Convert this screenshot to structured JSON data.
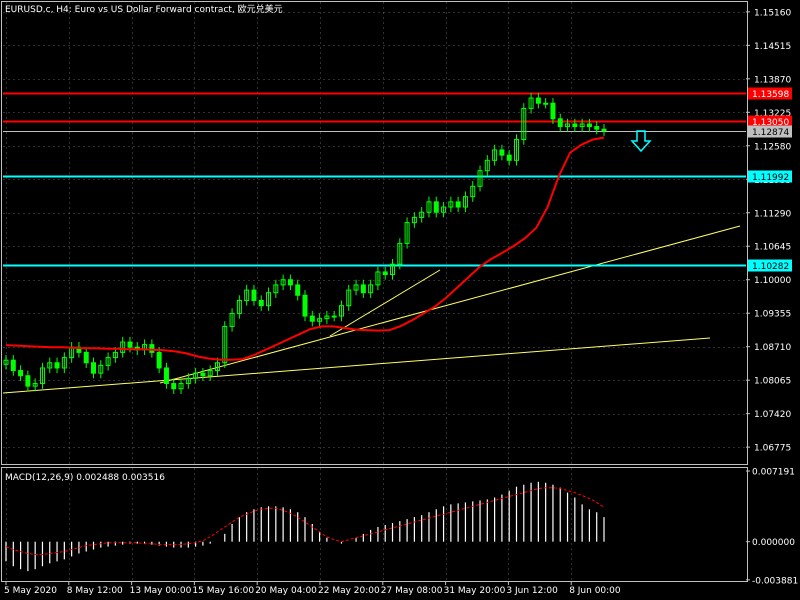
{
  "header": {
    "title": "EURUSD.c, H4:  Euro vs US Dollar Forward contract, 欧元兑美元",
    "macd_label": "MACD(12,26,9) 0.002488 0.003516"
  },
  "colors": {
    "background": "#000000",
    "grid": "#c0c0c0",
    "bull": "#00ff00",
    "ma": "#ff0000",
    "resistance": "#ff0000",
    "support": "#00ffff",
    "trend": "#ffff66",
    "arrow": "#00ffff",
    "macd_hist": "#ffffff",
    "macd_signal": "#ff0000",
    "price_tag": "#c0c0c0"
  },
  "price_axis": {
    "ticks": [
      "1.15160",
      "1.14515",
      "1.13870",
      "1.13225",
      "1.12580",
      "1.11935",
      "1.11290",
      "1.10645",
      "1.10000",
      "1.09355",
      "1.08710",
      "1.08065",
      "1.07420",
      "1.06775"
    ],
    "min": 1.0645,
    "max": 1.1535
  },
  "levels": [
    {
      "name": "resistance-high",
      "price": 1.13598,
      "label": "1.13598",
      "color": "#ff0000",
      "text_color": "#ffffff"
    },
    {
      "name": "resistance-low",
      "price": 1.1305,
      "label": "1.13050",
      "color": "#ff0000",
      "text_color": "#ffffff"
    },
    {
      "name": "current-price",
      "price": 1.12874,
      "label": "1.12874",
      "color": "#c0c0c0",
      "text_color": "#000000"
    },
    {
      "name": "support-high",
      "price": 1.11992,
      "label": "1.11992",
      "color": "#00ffff",
      "text_color": "#000000"
    },
    {
      "name": "support-low",
      "price": 1.10282,
      "label": "1.10282",
      "color": "#00ffff",
      "text_color": "#000000"
    }
  ],
  "time_axis": {
    "labels": [
      "5 May 2020",
      "8 May 12:00",
      "13 May 00:00",
      "15 May 16:00",
      "20 May 04:00",
      "22 May 20:00",
      "27 May 08:00",
      "31 May 20:00",
      "3 Jun 12:00",
      "8 Jun 00:00"
    ]
  },
  "macd_axis": {
    "ticks": [
      "0.007191",
      "0.000000",
      "-0.003881"
    ],
    "max": 0.0075,
    "min": -0.004
  },
  "chart_data": {
    "type": "line",
    "title": "EURUSD.c, H4",
    "series": [
      {
        "name": "EURUSD.c",
        "values": [
          1.0845,
          1.0825,
          1.0815,
          1.0795,
          1.08,
          1.083,
          1.084,
          1.083,
          1.085,
          1.087,
          1.086,
          1.084,
          1.082,
          1.0835,
          1.085,
          1.086,
          1.088,
          1.087,
          1.0865,
          1.0875,
          1.086,
          1.083,
          1.08,
          1.079,
          1.08,
          1.081,
          1.082,
          1.0815,
          1.0825,
          1.084,
          1.091,
          1.0935,
          1.096,
          1.098,
          1.096,
          1.095,
          1.0975,
          1.099,
          1.1,
          1.099,
          1.097,
          1.093,
          1.092,
          1.0925,
          1.093,
          1.093,
          1.095,
          1.098,
          1.099,
          1.0975,
          1.099,
          1.1015,
          1.101,
          1.103,
          1.107,
          1.111,
          1.112,
          1.113,
          1.115,
          1.113,
          1.114,
          1.115,
          1.114,
          1.116,
          1.118,
          1.121,
          1.123,
          1.125,
          1.124,
          1.123,
          1.127,
          1.133,
          1.135,
          1.134,
          1.134,
          1.131,
          1.1295,
          1.13,
          1.1295,
          1.13,
          1.1295,
          1.129,
          1.1287
        ]
      },
      {
        "name": "MA",
        "values": [
          1.0874,
          1.0873,
          1.0872,
          1.0871,
          1.087,
          1.087,
          1.0869,
          1.0868,
          1.0868,
          1.0867,
          1.0867,
          1.0866,
          1.0866,
          1.0865,
          1.0864,
          1.0862,
          1.0858,
          1.0852,
          1.0848,
          1.0846,
          1.0846,
          1.0847,
          1.0855,
          1.0865,
          1.0875,
          1.0885,
          1.0895,
          1.0905,
          1.091,
          1.091,
          1.0907,
          1.0904,
          1.0903,
          1.0902,
          1.0903,
          1.0911,
          1.0922,
          1.0935,
          1.0948,
          1.0965,
          1.0985,
          1.1005,
          1.1025,
          1.104,
          1.1052,
          1.1065,
          1.108,
          1.11,
          1.114,
          1.12,
          1.1245,
          1.126,
          1.127,
          1.1274
        ]
      }
    ],
    "macd": {
      "histogram": [
        -0.002,
        -0.0025,
        -0.0028,
        -0.003,
        -0.0028,
        -0.0025,
        -0.0022,
        -0.002,
        -0.0018,
        -0.0015,
        -0.0012,
        -0.001,
        -0.0008,
        -0.0006,
        -0.0005,
        -0.0004,
        -0.0003,
        -0.0002,
        -0.0002,
        -0.0002,
        -0.0003,
        -0.0004,
        -0.0005,
        -0.0006,
        -0.0006,
        -0.0006,
        -0.0005,
        -0.0004,
        -0.0002,
        0.0,
        0.0008,
        0.0018,
        0.0025,
        0.003,
        0.0033,
        0.0035,
        0.0036,
        0.0036,
        0.0035,
        0.0033,
        0.003,
        0.0025,
        0.0018,
        0.001,
        0.0004,
        0.0,
        -0.0002,
        0.0,
        0.0004,
        0.0008,
        0.0012,
        0.0015,
        0.0017,
        0.0019,
        0.0021,
        0.0023,
        0.0025,
        0.0027,
        0.003,
        0.0033,
        0.0036,
        0.0038,
        0.0039,
        0.004,
        0.0041,
        0.0042,
        0.0043,
        0.0045,
        0.0048,
        0.0052,
        0.0056,
        0.0058,
        0.006,
        0.0061,
        0.006,
        0.0058,
        0.0055,
        0.005,
        0.0045,
        0.0038,
        0.0033,
        0.003,
        0.0025
      ],
      "signal": [
        -0.0005,
        -0.0008,
        -0.001,
        -0.0012,
        -0.0013,
        -0.0013,
        -0.0012,
        -0.0011,
        -0.001,
        -0.0008,
        -0.0006,
        -0.0004,
        -0.0003,
        -0.0002,
        -0.0001,
        -0.0001,
        -0.0001,
        -0.0001,
        -0.0001,
        -0.0002,
        -0.0002,
        -0.0003,
        -0.0003,
        -0.0003,
        -0.0003,
        -0.0002,
        -0.0001,
        0.0001,
        0.0005,
        0.001,
        0.0015,
        0.002,
        0.0025,
        0.0028,
        0.0031,
        0.0033,
        0.0034,
        0.0034,
        0.0032,
        0.0029,
        0.0025,
        0.002,
        0.0015,
        0.001,
        0.0005,
        0.0002,
        0.0,
        0.0002,
        0.0004,
        0.0006,
        0.0008,
        0.001,
        0.0012,
        0.0014,
        0.0016,
        0.0018,
        0.002,
        0.0022,
        0.0024,
        0.0026,
        0.0028,
        0.003,
        0.0032,
        0.0034,
        0.0036,
        0.0038,
        0.004,
        0.0042,
        0.0044,
        0.0046,
        0.0048,
        0.005,
        0.0052,
        0.0054,
        0.0055,
        0.0055,
        0.0054,
        0.0052,
        0.005,
        0.0047,
        0.0044,
        0.004,
        0.0035
      ]
    }
  }
}
